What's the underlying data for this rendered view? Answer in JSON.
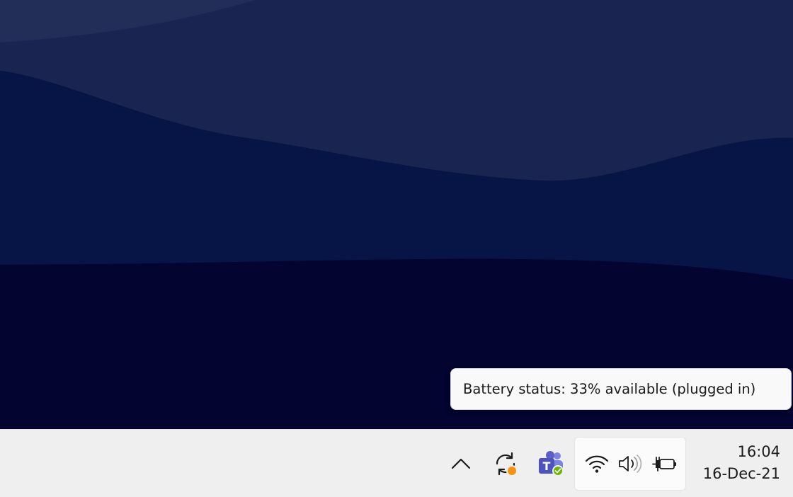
{
  "tooltip": {
    "text": "Battery status: 33% available (plugged in)"
  },
  "taskbar": {
    "tray": {
      "overflow_icon": "chevron-up-icon",
      "sync_icon": "sync-icon",
      "sync_badge_color": "#f7930e",
      "teams_icon": "teams-icon",
      "teams_color": "#5b5fc7",
      "teams_status_color": "#6bb700",
      "quick_settings": {
        "wifi_icon": "wifi-icon",
        "volume_icon": "volume-icon",
        "battery_icon": "battery-charging-icon"
      }
    },
    "clock": {
      "time": "16:04",
      "date": "16-Dec-21"
    }
  },
  "colors": {
    "desktop_background": "#030430",
    "taskbar_background": "#efefef"
  }
}
